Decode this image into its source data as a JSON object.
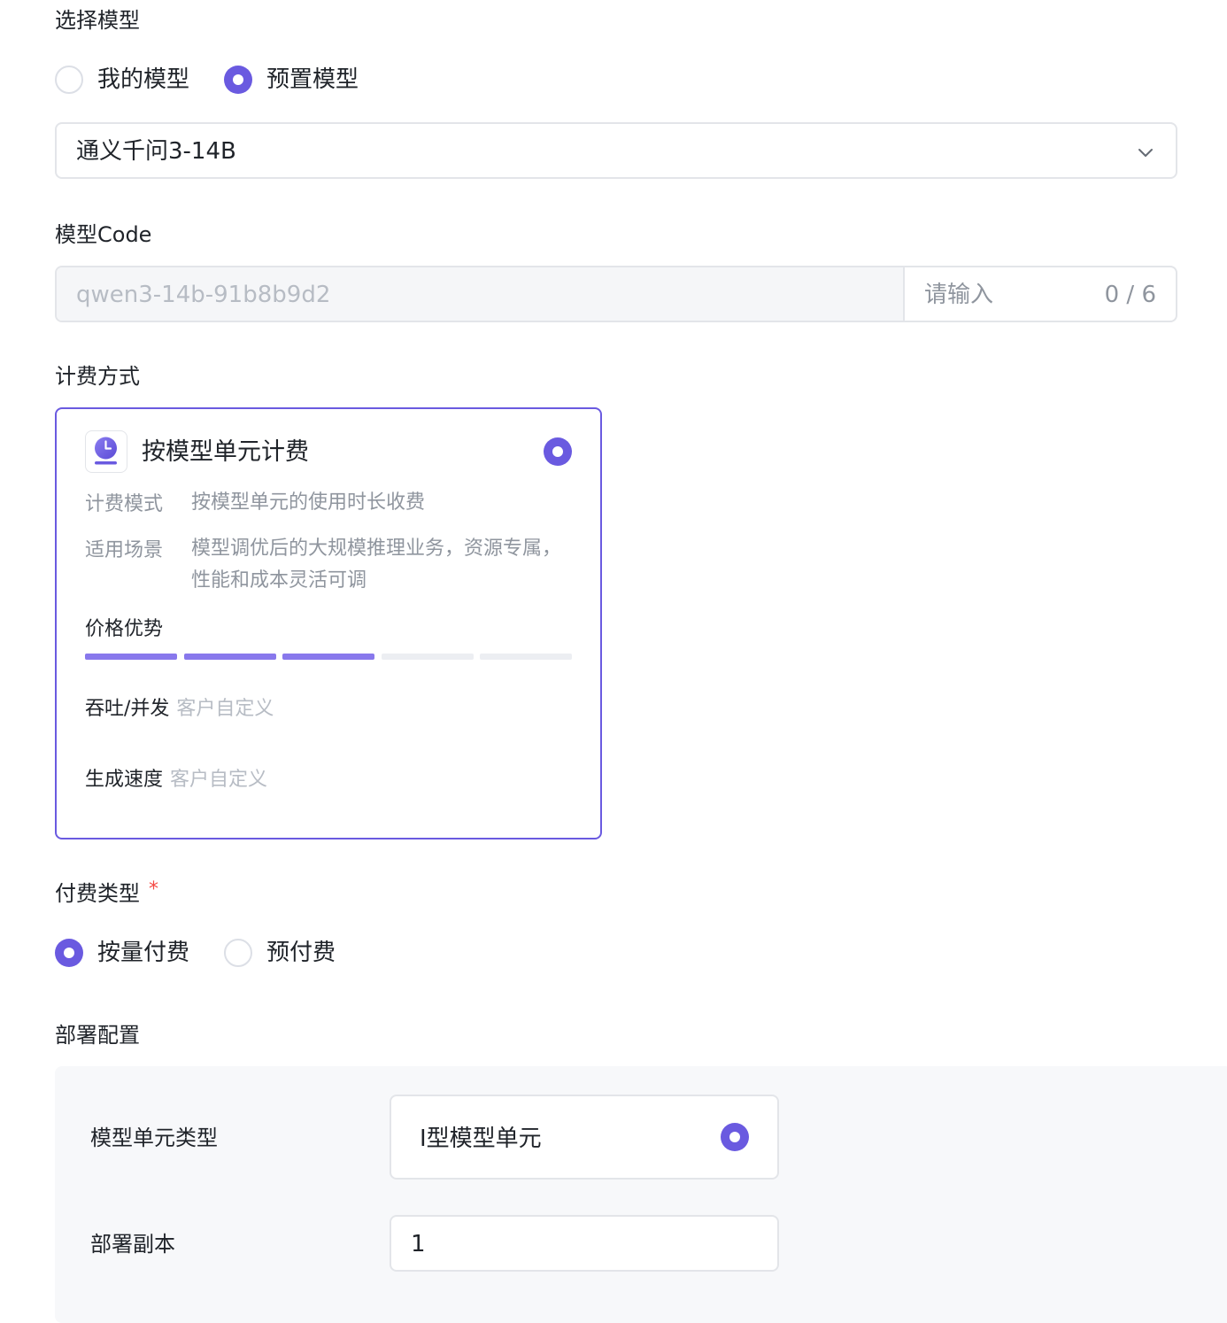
{
  "model_select": {
    "label": "选择模型",
    "options": [
      {
        "label": "我的模型",
        "selected": false
      },
      {
        "label": "预置模型",
        "selected": true
      }
    ],
    "dropdown_value": "通义千问3-14B"
  },
  "model_code": {
    "label": "模型Code",
    "prefix_value": "qwen3-14b-91b8b9d2",
    "input_placeholder": "请输入",
    "counter": "0 / 6"
  },
  "billing": {
    "label": "计费方式",
    "card": {
      "title": "按模型单元计费",
      "selected": true,
      "mode_key": "计费模式",
      "mode_value": "按模型单元的使用时长收费",
      "scenario_key": "适用场景",
      "scenario_value": "模型调优后的大规模推理业务，资源专属，性能和成本灵活可调",
      "price_label": "价格优势",
      "price_level": 3,
      "price_level_max": 5,
      "throughput_key": "吞吐/并发",
      "throughput_value": "客户自定义",
      "speed_key": "生成速度",
      "speed_value": "客户自定义"
    }
  },
  "payment": {
    "label": "付费类型",
    "required_mark": "*",
    "options": [
      {
        "label": "按量付费",
        "selected": true
      },
      {
        "label": "预付费",
        "selected": false
      }
    ]
  },
  "deploy": {
    "label": "部署配置",
    "unit_type_key": "模型单元类型",
    "unit_type_value": "I型模型单元",
    "replica_key": "部署副本",
    "replica_value": "1"
  },
  "colors": {
    "accent": "#6a5ae0",
    "bar_fill": "#8878ec",
    "bar_empty": "#eceef2"
  }
}
